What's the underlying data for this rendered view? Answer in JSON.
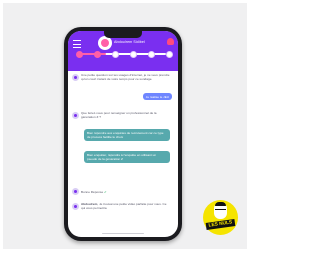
{
  "header": {
    "title": "Abdoulrem Sidibel",
    "progress_fraction": 0.3,
    "steps": [
      true,
      true,
      false,
      false,
      false,
      false
    ]
  },
  "chat": {
    "bot_intro": "Une petite question sur tes usages d'internet, je ne veux prendre qu'un court instant de votre temps pour ce sondage.",
    "user_reply": "Je réalise le JEU",
    "bot_question": "Que feriez-vous pour renseigner un professionnel de la génération Z ?",
    "option_1": "Bien répondre aux enquêtes de recrutement car ce type de process facilite le choix",
    "option_2": "Bien enquêter, répondre à l'enquête en utilisant un pseudo de la génération Z",
    "bot_ok": "Bonne Réponse",
    "bot_footer_name": "Abdoulrem",
    "bot_footer": ", Je trouvai une petite vidéo parfaite pour vous. Ce qui vous permettra"
  },
  "logo": {
    "text": "LES NULS"
  },
  "colors": {
    "header": "#7a2ff0",
    "accent": "#ff5fa8",
    "user_bubble": "#6f86ff",
    "option_bubble": "#57a9ad",
    "logo_yellow": "#f5e400"
  }
}
